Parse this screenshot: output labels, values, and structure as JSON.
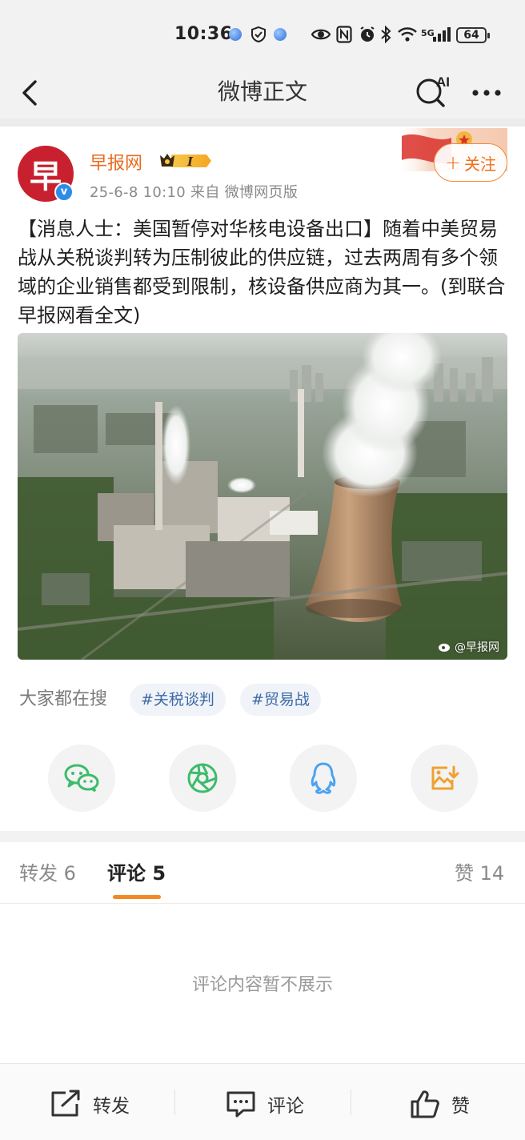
{
  "status_bar": {
    "time": "10:36",
    "network": "5G",
    "battery": "64",
    "icons": [
      "app-dot-icon",
      "vpn-icon",
      "app-dot-icon",
      "eye-icon",
      "nfc-icon",
      "alarm-icon",
      "bluetooth-icon",
      "wifi-icon",
      "signal-icon",
      "battery-icon"
    ]
  },
  "nav": {
    "title": "微博正文",
    "ai_label": "AI",
    "icons": [
      "back-icon",
      "ai-search-icon",
      "more-icon"
    ]
  },
  "post": {
    "author": "早报网",
    "avatar_char": "早",
    "verified_mark": "v",
    "vip_level": "I",
    "meta": "25-6-8 10:10   来自 微博网页版",
    "follow": {
      "plus": "+",
      "label": "关注"
    },
    "text": "【消息人士：美国暂停对华核电设备出口】随着中美贸易战从关税谈判转为压制彼此的供应链，过去两周有多个领域的企业销售都受到限制，核设备供应商为其一。(到联合早报网看全文)",
    "image_watermark": "@早报网"
  },
  "search": {
    "label": "大家都在搜",
    "tags": [
      "#关税谈判",
      "#贸易战"
    ]
  },
  "share": {
    "targets": [
      {
        "icon": "wechat-icon",
        "color": "#3dbb6a"
      },
      {
        "icon": "moments-icon",
        "color": "#3dbb6a"
      },
      {
        "icon": "qq-icon",
        "color": "#4aa3f0"
      },
      {
        "icon": "save-image-icon",
        "color": "#f0a030"
      }
    ]
  },
  "tabs": {
    "repost": {
      "label": "转发",
      "count": "6"
    },
    "comment": {
      "label": "评论",
      "count": "5"
    },
    "like": {
      "label": "赞",
      "count": "14"
    }
  },
  "comments": {
    "empty_text": "评论内容暂不展示"
  },
  "bottom": {
    "repost": "转发",
    "comment": "评论",
    "like": "赞"
  },
  "colors": {
    "accent": "#f08b24",
    "author": "#e96a1f",
    "tag_text": "#3d6aa6"
  }
}
